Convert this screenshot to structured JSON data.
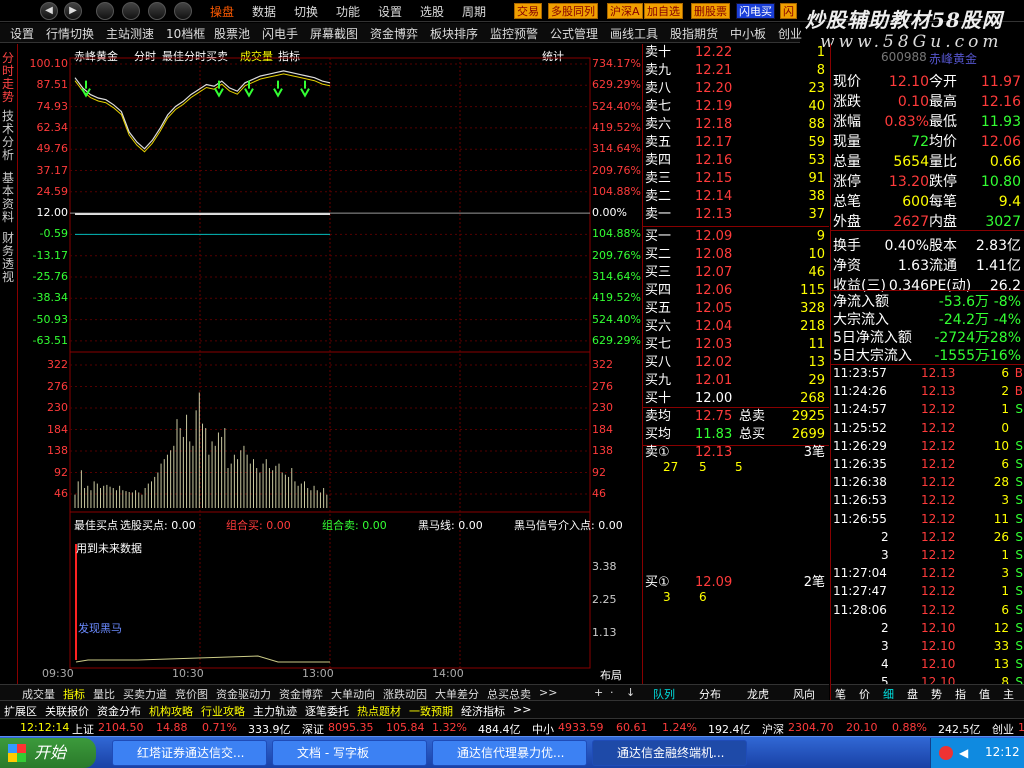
{
  "menu": {
    "items": [
      "操盘",
      "数据",
      "切换",
      "功能",
      "设置",
      "选股",
      "周期"
    ],
    "quick": [
      "交易",
      "多股同列",
      "沪深A",
      "加自选",
      "删股票",
      "闪电买",
      "闪"
    ],
    "brand": "炒股辅助教材58股网",
    "brand_url": "www.58Gu.com"
  },
  "toolbar": [
    "设置",
    "行情切换",
    "主站测速",
    "10档框",
    "股票池",
    "闪电手",
    "屏幕截图",
    "资金博弈",
    "板块排序",
    "监控预警",
    "公式管理",
    "画线工具",
    "股指期货",
    "中小板",
    "创业"
  ],
  "left_tabs": [
    "分时走势",
    "技术分析",
    "基本资料",
    "财务透视"
  ],
  "chart": {
    "title": "赤峰黄金",
    "modes": [
      "分时",
      "最佳分时买卖",
      "成交量",
      "指标"
    ],
    "stat_label": "统计",
    "price_left": [
      "100.10",
      "87.51",
      "74.93",
      "62.34",
      "49.76",
      "37.17",
      "24.59",
      "12.00",
      "-0.59",
      "-13.17",
      "-25.76",
      "-38.34",
      "-50.93",
      "-63.51"
    ],
    "price_right": [
      "734.17%",
      "629.29%",
      "524.40%",
      "419.52%",
      "314.64%",
      "209.76%",
      "104.88%",
      "0.00%",
      "104.88%",
      "209.76%",
      "314.64%",
      "419.52%",
      "524.40%",
      "629.29%"
    ],
    "vol_left": [
      "322",
      "276",
      "230",
      "184",
      "138",
      "92",
      "46"
    ],
    "vol_right": [
      "322",
      "276",
      "230",
      "184",
      "138",
      "92",
      "46"
    ],
    "ind_right": [
      "3.38",
      "2.25",
      "1.13"
    ],
    "ind_header": [
      {
        "t": "最佳买点",
        "c": "white"
      },
      {
        "t": "选股买点: 0.00",
        "c": "white"
      },
      {
        "t": "组合买: 0.00",
        "c": "red"
      },
      {
        "t": "组合卖: 0.00",
        "c": "green"
      },
      {
        "t": "黑马线: 0.00",
        "c": "white"
      },
      {
        "t": "黑马信号介入点: 0.00",
        "c": "white"
      }
    ],
    "future_note": "用到未来数据",
    "dark_horse": "发现黑马",
    "time_labels": [
      "09:30",
      "10:30",
      "13:00",
      "14:00"
    ],
    "layout_label": "布局",
    "chart_data": {
      "type": "line",
      "price_ylim": [
        -63.51,
        100.1
      ],
      "prev_close": 12.0,
      "price_series": [
        {
          "name": "price",
          "values": [
            92,
            86,
            82,
            80,
            79,
            76,
            72,
            60,
            54,
            50,
            55,
            62,
            70,
            75,
            78,
            82,
            85,
            88,
            87,
            90,
            86,
            84,
            89,
            91,
            93,
            94,
            95,
            96,
            95,
            94,
            93,
            92,
            90,
            89
          ]
        }
      ],
      "volume_values": [
        30,
        60,
        85,
        45,
        50,
        40,
        60,
        55,
        45,
        50,
        52,
        48,
        45,
        40,
        50,
        40,
        38,
        36,
        35,
        40,
        35,
        30,
        45,
        55,
        60,
        70,
        80,
        100,
        110,
        120,
        130,
        140,
        200,
        180,
        160,
        210,
        150,
        140,
        220,
        260,
        190,
        180,
        120,
        150,
        140,
        170,
        160,
        180,
        90,
        100,
        120,
        110,
        130,
        140,
        120,
        100,
        110,
        90,
        80,
        100,
        110,
        90,
        85,
        95,
        100,
        80,
        75,
        70,
        90,
        60,
        50,
        55,
        60,
        45,
        40,
        50,
        40,
        35,
        45,
        30
      ],
      "vol_ylim": [
        0,
        322
      ]
    }
  },
  "orderbook": {
    "sells": [
      {
        "l": "卖十",
        "p": "12.22",
        "v": "1"
      },
      {
        "l": "卖九",
        "p": "12.21",
        "v": "8"
      },
      {
        "l": "卖八",
        "p": "12.20",
        "v": "23"
      },
      {
        "l": "卖七",
        "p": "12.19",
        "v": "40"
      },
      {
        "l": "卖六",
        "p": "12.18",
        "v": "88"
      },
      {
        "l": "卖五",
        "p": "12.17",
        "v": "59"
      },
      {
        "l": "卖四",
        "p": "12.16",
        "v": "53"
      },
      {
        "l": "卖三",
        "p": "12.15",
        "v": "91"
      },
      {
        "l": "卖二",
        "p": "12.14",
        "v": "38"
      },
      {
        "l": "卖一",
        "p": "12.13",
        "v": "37"
      }
    ],
    "buys": [
      {
        "l": "买一",
        "p": "12.09",
        "v": "9"
      },
      {
        "l": "买二",
        "p": "12.08",
        "v": "10"
      },
      {
        "l": "买三",
        "p": "12.07",
        "v": "46"
      },
      {
        "l": "买四",
        "p": "12.06",
        "v": "115"
      },
      {
        "l": "买五",
        "p": "12.05",
        "v": "328"
      },
      {
        "l": "买六",
        "p": "12.04",
        "v": "218"
      },
      {
        "l": "买七",
        "p": "12.03",
        "v": "11"
      },
      {
        "l": "买八",
        "p": "12.02",
        "v": "13"
      },
      {
        "l": "买九",
        "p": "12.01",
        "v": "29"
      },
      {
        "l": "买十",
        "p": "12.00",
        "v": "268"
      }
    ],
    "sell_avg_l": "卖均",
    "sell_avg": "12.75",
    "sell_total_l": "总卖",
    "sell_total": "2925",
    "buy_avg_l": "买均",
    "buy_avg": "11.83",
    "buy_total_l": "总买",
    "buy_total": "2699",
    "sell1_l": "卖①",
    "sell1_p": "12.13",
    "sell1_n": "3笔",
    "sell1_queue": [
      "27",
      "5",
      "5"
    ],
    "buy1_l": "买①",
    "buy1_p": "12.09",
    "buy1_n": "2笔",
    "buy1_queue": [
      "3",
      "6"
    ],
    "tabs": [
      "深",
      "图",
      "队列",
      "分布",
      "龙虎",
      "风向"
    ]
  },
  "quote": {
    "code": "600988",
    "name": "赤峰黄金",
    "rows": [
      {
        "a": "现价",
        "av": "12.10",
        "b": "今开",
        "bv": "11.97"
      },
      {
        "a": "涨跌",
        "av": "0.10",
        "b": "最高",
        "bv": "12.16"
      },
      {
        "a": "涨幅",
        "av": "0.83%",
        "b": "最低",
        "bv": "11.93"
      },
      {
        "a": "现量",
        "av": "72",
        "b": "均价",
        "bv": "12.06"
      },
      {
        "a": "总量",
        "av": "5654",
        "b": "量比",
        "bv": "0.66"
      },
      {
        "a": "涨停",
        "av": "13.20",
        "b": "跌停",
        "bv": "10.80"
      },
      {
        "a": "总笔",
        "av": "600",
        "b": "每笔",
        "bv": "9.4"
      },
      {
        "a": "外盘",
        "av": "2627",
        "b": "内盘",
        "bv": "3027"
      },
      {
        "a": "换手",
        "av": "0.40%",
        "b": "股本",
        "bv": "2.83亿"
      },
      {
        "a": "净资",
        "av": "1.63",
        "b": "流通",
        "bv": "1.41亿"
      },
      {
        "a": "收益(三)",
        "av": "0.346",
        "b": "PE(动)",
        "bv": "26.2"
      }
    ],
    "flows": [
      {
        "l": "净流入额",
        "v": "-53.6万",
        "p": "-8%"
      },
      {
        "l": "大宗流入",
        "v": "-24.2万",
        "p": "-4%"
      },
      {
        "l": "5日净流入额",
        "v": "-2724万",
        "p": "-28%"
      },
      {
        "l": "5日大宗流入",
        "v": "-1555万",
        "p": "-16%"
      }
    ],
    "ticks": [
      {
        "t": "11:23:57",
        "p": "12.13",
        "v": "6",
        "s": "B"
      },
      {
        "t": "11:24:26",
        "p": "12.13",
        "v": "2",
        "s": "B"
      },
      {
        "t": "11:24:57",
        "p": "12.12",
        "v": "1",
        "s": "S"
      },
      {
        "t": "11:25:52",
        "p": "12.12",
        "v": "0",
        "s": ""
      },
      {
        "t": "11:26:29",
        "p": "12.12",
        "v": "10",
        "s": "S"
      },
      {
        "t": "11:26:35",
        "p": "12.12",
        "v": "6",
        "s": "S"
      },
      {
        "t": "11:26:38",
        "p": "12.12",
        "v": "28",
        "s": "S"
      },
      {
        "t": "11:26:53",
        "p": "12.12",
        "v": "3",
        "s": "S"
      },
      {
        "t": "11:26:55",
        "p": "12.12",
        "v": "11",
        "s": "S"
      },
      {
        "t": "2",
        "p": "12.12",
        "v": "26",
        "s": "S"
      },
      {
        "t": "3",
        "p": "12.12",
        "v": "1",
        "s": "S"
      },
      {
        "t": "11:27:04",
        "p": "12.12",
        "v": "3",
        "s": "S"
      },
      {
        "t": "11:27:47",
        "p": "12.12",
        "v": "1",
        "s": "S"
      },
      {
        "t": "11:28:06",
        "p": "12.12",
        "v": "6",
        "s": "S"
      },
      {
        "t": "2",
        "p": "12.10",
        "v": "12",
        "s": "S"
      },
      {
        "t": "3",
        "p": "12.10",
        "v": "33",
        "s": "S"
      },
      {
        "t": "4",
        "p": "12.10",
        "v": "13",
        "s": "S"
      },
      {
        "t": "5",
        "p": "12.10",
        "v": "8",
        "s": "S"
      }
    ],
    "bottom_tabs": [
      "笔",
      "价",
      "细",
      "盘",
      "势",
      "指",
      "值",
      "主"
    ]
  },
  "bottom_tabs": [
    "成交量",
    "指标",
    "量比",
    "买卖力道",
    "竞价图",
    "资金驱动力",
    "资金博弈",
    "大单动向",
    "涨跌动因",
    "大单差分",
    "总买总卖",
    ">>"
  ],
  "status_tabs": [
    "扩展区",
    "关联报价",
    "资金分布",
    "机构攻略",
    "行业攻略",
    "主力轨迹",
    "逐笔委托",
    "热点题材",
    "一致预期",
    "经济指标",
    ">>"
  ],
  "ticker": {
    "time": "12:12:14",
    "items": [
      {
        "n": "上证",
        "v": "2104.50",
        "c": "14.88",
        "p": "0.71%",
        "a": "333.9亿"
      },
      {
        "n": "深证",
        "v": "8095.35",
        "c": "105.84",
        "p": "1.32%",
        "a": "484.4亿"
      },
      {
        "n": "中小",
        "v": "4933.59",
        "c": "60.61",
        "p": "1.24%",
        "a": "192.4亿"
      },
      {
        "n": "沪深",
        "v": "2304.70",
        "c": "20.10",
        "p": "0.88%",
        "a": "242.5亿"
      },
      {
        "n": "创业",
        "v": "1261.30",
        "c": "",
        "p": "",
        "a": ""
      }
    ]
  },
  "taskbar": {
    "start": "开始",
    "tasks": [
      "红塔证券通达信交...",
      "文档 - 写字板",
      "通达信代理暴力优...",
      "通达信金融终端机..."
    ],
    "clock": "12:12"
  }
}
